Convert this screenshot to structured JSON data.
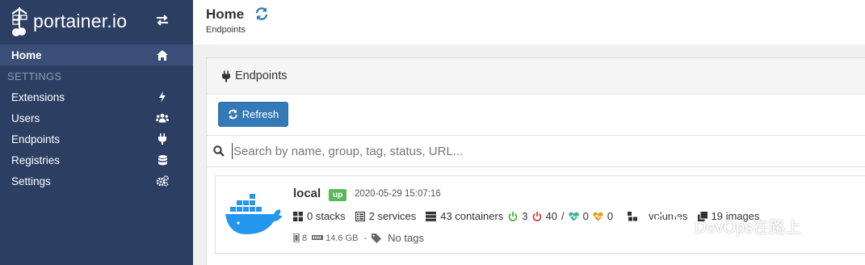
{
  "brand": {
    "name": "portainer.io"
  },
  "sidebar": {
    "home_label": "Home",
    "settings_heading": "SETTINGS",
    "items": [
      {
        "label": "Extensions",
        "icon": "bolt-icon"
      },
      {
        "label": "Users",
        "icon": "users-icon"
      },
      {
        "label": "Endpoints",
        "icon": "plug-icon"
      },
      {
        "label": "Registries",
        "icon": "database-icon"
      },
      {
        "label": "Settings",
        "icon": "cogs-icon"
      }
    ]
  },
  "header": {
    "title": "Home",
    "breadcrumb": "Endpoints"
  },
  "panel": {
    "title": "Endpoints",
    "refresh_label": "Refresh",
    "search_placeholder": "Search by name, group, tag, status, URL..."
  },
  "endpoint": {
    "name": "local",
    "status": "up",
    "timestamp": "2020-05-29 15:07:16",
    "stacks": "0 stacks",
    "services": "2 services",
    "containers": "43 containers",
    "running": "3",
    "stopped": "40",
    "separator": "/",
    "healthy": "0",
    "unhealthy": "0",
    "volumes": "volumes",
    "images": "19 images",
    "cpu": "8",
    "memory": "14.6 GB",
    "tags": "No tags"
  },
  "watermark": {
    "text": "DevOps在路上"
  },
  "colors": {
    "sidebar_bg": "#2d3e63",
    "primary": "#337ab7",
    "success": "#5cb85c",
    "running": "#2ab02a",
    "stopped": "#c9302c",
    "healthy": "#3ab0a0",
    "unhealthy": "#e0a020",
    "docker_blue": "#2496ed"
  }
}
